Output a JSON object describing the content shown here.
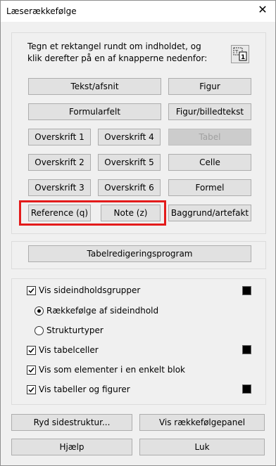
{
  "window": {
    "title": "Læserækkefølge",
    "close_glyph": "✕"
  },
  "instruction": "Tegn et rektangel rundt om indholdet, og klik derefter på en af knapperne nedenfor:",
  "draw_icon": "draw-rectangle-icon",
  "buttons": {
    "text_paragraph": "Tekst/afsnit",
    "figure": "Figur",
    "form_field": "Formularfelt",
    "figure_caption": "Figur/billedtekst",
    "heading1": "Overskrift 1",
    "heading4": "Overskrift 4",
    "table": "Tabel",
    "heading2": "Overskrift 2",
    "heading5": "Overskrift 5",
    "cell": "Celle",
    "heading3": "Overskrift 3",
    "heading6": "Overskrift 6",
    "formula": "Formel",
    "reference": "Reference (q)",
    "note": "Note (z)",
    "background": "Baggrund/artefakt",
    "table_editor": "Tabelredigeringsprogram",
    "clear_structure": "Ryd sidestruktur...",
    "show_order_panel": "Vis rækkefølgepanel",
    "help": "Hjælp",
    "close": "Luk"
  },
  "options": {
    "show_content_groups": "Vis sideindholdsgrupper",
    "content_order": "Rækkefølge af sideindhold",
    "structure_types": "Strukturtyper",
    "show_table_cells": "Vis tabelceller",
    "show_as_block": "Vis som elementer i en enkelt blok",
    "show_tables_figures": "Vis tabeller og figurer"
  },
  "colors": {
    "highlight": "#e31b1b",
    "swatch": "#000000"
  }
}
